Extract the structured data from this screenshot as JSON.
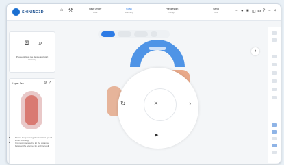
{
  "app": {
    "brand": "SHINING3D"
  },
  "steps": [
    {
      "title": "New Order",
      "sub": "Data"
    },
    {
      "title": "Scan",
      "sub": "Scanning"
    },
    {
      "title": "Pre-design",
      "sub": "Design"
    },
    {
      "title": "Send",
      "sub": "Data"
    }
  ],
  "sidebar": {
    "scan_hint": "Please pick up the device and start scanning",
    "section_title": "Upper Jaw",
    "notes": [
      "Please keep moving at a constant speed while scanning.",
      "It is recommended to let the distance between the scanner tip and the tooth"
    ],
    "device_label": "1X"
  },
  "ring": {
    "rotate_icon": "rotate-icon",
    "close_icon": "close-icon",
    "next_icon": "chevron-right-icon",
    "play_icon": "play-icon"
  },
  "colors": {
    "accent": "#2d7be5",
    "brand": "#1a6fd1"
  }
}
